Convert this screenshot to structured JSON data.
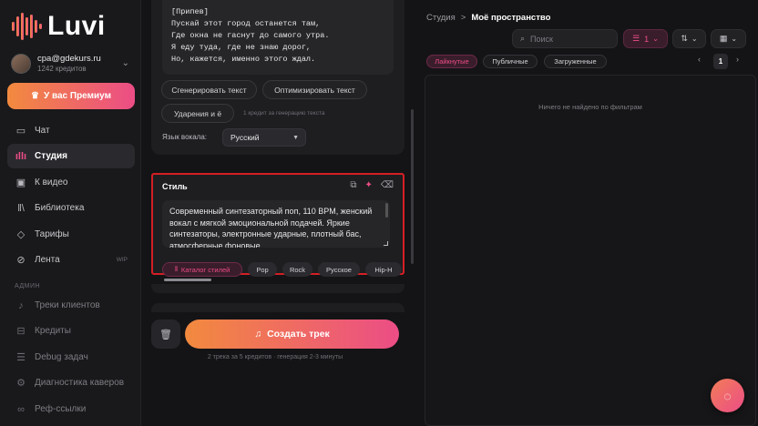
{
  "sidebar": {
    "logo_text": "Luvi",
    "account": {
      "email": "cpa@gdekurs.ru",
      "credits": "1242 кредитов"
    },
    "premium_label": "У вас Премиум",
    "nav": [
      {
        "label": "Чат",
        "icon": "chat-icon"
      },
      {
        "label": "Студия",
        "icon": "waveform-icon",
        "active": true
      },
      {
        "label": "К видео",
        "icon": "video-icon"
      },
      {
        "label": "Библиотека",
        "icon": "library-icon"
      },
      {
        "label": "Тарифы",
        "icon": "diamond-icon"
      },
      {
        "label": "Лента",
        "icon": "compass-icon",
        "badge": "WIP"
      }
    ],
    "admin_label": "АДМИН",
    "admin_nav": [
      {
        "label": "Треки клиентов",
        "icon": "music-note-icon"
      },
      {
        "label": "Кредиты",
        "icon": "credits-icon"
      },
      {
        "label": "Debug задач",
        "icon": "debug-icon"
      },
      {
        "label": "Диагностика каверов",
        "icon": "diagnostics-icon"
      },
      {
        "label": "Реф-ссылки",
        "icon": "link-icon"
      }
    ]
  },
  "lyrics": {
    "lines": [
      "[Припев]",
      "Пускай этот город останется там,",
      "Где окна не гаснут до самого утра.",
      "Я еду туда, где не знаю дорог,",
      "Но, кажется, именно этого ждал."
    ],
    "buttons": {
      "generate": "Сгенерировать текст",
      "optimize": "Оптимизировать текст",
      "stress": "Ударения и ё"
    },
    "hint": "1 кредит за генерацию текста",
    "vocal_language_label": "Язык вокала:",
    "vocal_language_value": "Русский"
  },
  "style": {
    "title": "Стиль",
    "text": "Современный синтезаторный поп, 110 BPM, женский вокал с мягкой эмоциональной подачей. Яркие синтезаторы, электронные ударные, плотный бас, атмосферные фоновые",
    "tags": [
      "Каталог стилей",
      "Pop",
      "Rock",
      "Русское",
      "Hip-H"
    ],
    "icons": [
      "copy-icon",
      "magic-wand-icon",
      "eraser-icon"
    ]
  },
  "actions": {
    "create_label": "Создать трек",
    "gen_info": "2 трека за 5 кредитов · генерация 2-3 минуты"
  },
  "right": {
    "breadcrumb": {
      "root": "Студия",
      "separator": ">",
      "current": "Моё пространство"
    },
    "search_placeholder": "Поиск",
    "filter_count": "1",
    "filters": [
      "Лайкнутые",
      "Публичные",
      "Загруженные"
    ],
    "page": "1",
    "empty_text": "Ничего не найдено по фильтрам"
  },
  "colors": {
    "accent": "#ec4d86",
    "accent2": "#f28a3e",
    "highlight_border": "#d41f24"
  }
}
